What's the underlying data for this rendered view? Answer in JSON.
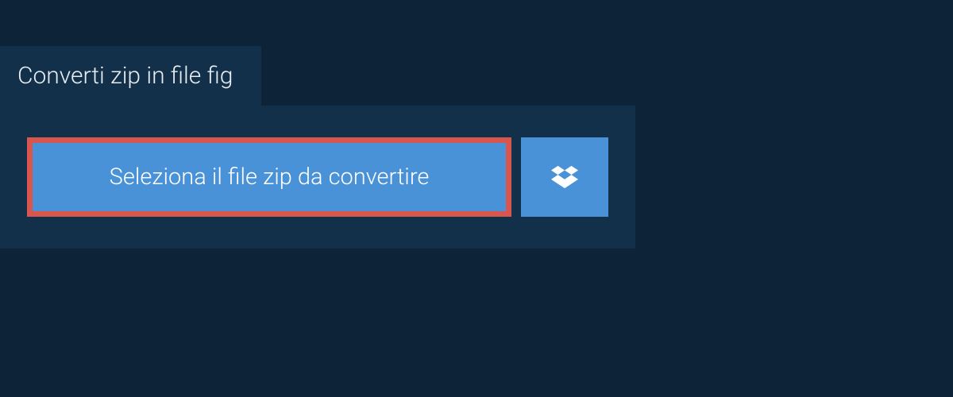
{
  "tab": {
    "title": "Converti zip in file fig"
  },
  "buttons": {
    "select_file": "Seleziona il file zip da convertire"
  }
}
